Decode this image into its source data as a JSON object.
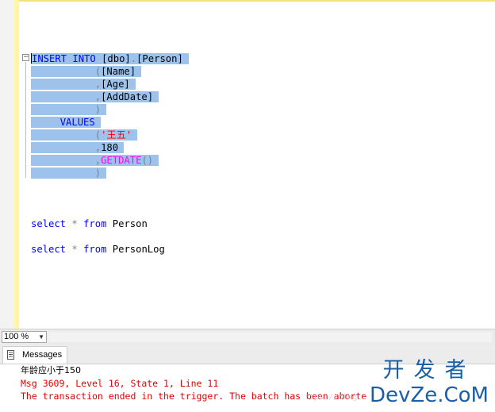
{
  "editor": {
    "lines": {
      "l1": {
        "kw": "INSERT INTO",
        "obj1": "[dbo]",
        "dot": ".",
        "obj2": "[Person]"
      },
      "l2": {
        "paren": "(",
        "col": "[Name]"
      },
      "l3": {
        "comma": ",",
        "col": "[Age]"
      },
      "l4": {
        "comma": ",",
        "col": "[AddDate]"
      },
      "l5": {
        "paren": ")"
      },
      "l6": {
        "kw": "VALUES"
      },
      "l7": {
        "paren": "(",
        "str": "'王五'"
      },
      "l8": {
        "comma": ",",
        "num": "180"
      },
      "l9": {
        "comma": ",",
        "fn": "GETDATE",
        "parens": "()"
      },
      "l10": {
        "paren": ")"
      },
      "l11": {
        "kw1": "select",
        "star": "*",
        "kw2": "from",
        "table": "Person"
      },
      "l12": {
        "kw1": "select",
        "star": "*",
        "kw2": "from",
        "table": "PersonLog"
      }
    },
    "collapse_symbol": "−"
  },
  "zoom": {
    "value": "100 %"
  },
  "results": {
    "tab_label": "Messages",
    "messages": {
      "m1": "年龄应小于150",
      "m2": "Msg 3609, Level 16, State 1, Line 11",
      "m3": "The transaction ended in the trigger. The batch has been aborte",
      "ghost": "ttps://blog.c"
    }
  },
  "watermark": {
    "line1": "开发者",
    "line2": "DevZe.CoM"
  },
  "colors": {
    "selection": "#9dc3ec",
    "keyword": "#0000ff",
    "string": "#ff0000",
    "function": "#ff00ff",
    "error": "#e00000",
    "watermark": "#1a5fa6"
  }
}
